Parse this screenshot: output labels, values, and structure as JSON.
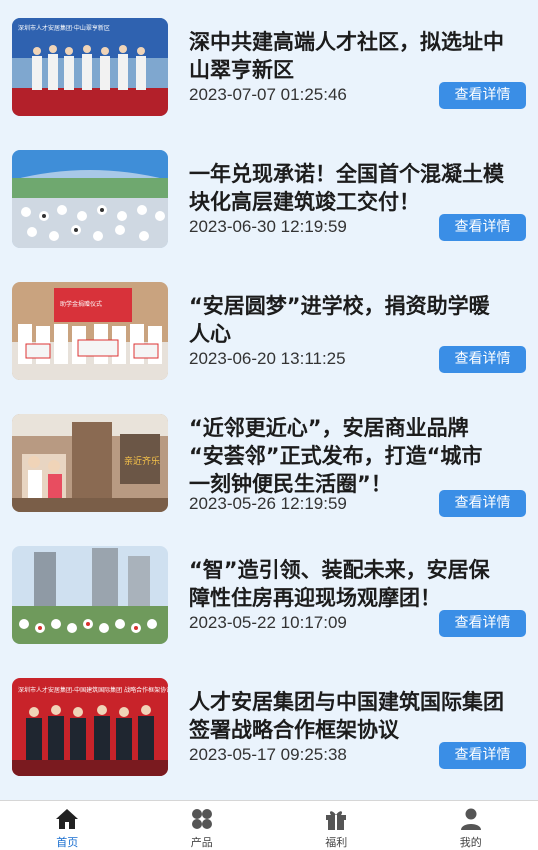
{
  "news": [
    {
      "title_line1": "深中共建高端人才社区，拟选址中",
      "title_line2": "山翠亨新区",
      "date": "2023-07-07 01:25:46",
      "button": "查看详情",
      "image": "signing-ceremony-photo"
    },
    {
      "title_line1": "一年兑现承诺！全国首个混凝土模",
      "title_line2": "块化高层建筑竣工交付！",
      "date": "2023-06-30 12:19:59",
      "button": "查看详情",
      "image": "event-tent-photo"
    },
    {
      "title_line1": "“安居圆梦”进学校，捐资助学暖",
      "title_line2": "人心",
      "date": "2023-06-20 13:11:25",
      "button": "查看详情",
      "image": "school-donation-photo"
    },
    {
      "title_line1": "“近邻更近心”，安居商业品牌",
      "title_line2": "“安荟邻”正式发布，打造“城市",
      "title_line3": "一刻钟便民生活圈”！",
      "date": "2023-05-26 12:19:59",
      "button": "查看详情",
      "image": "community-store-photo"
    },
    {
      "title_line1": "“智”造引领、装配未来，安居保",
      "title_line2": "障性住房再迎现场观摩团！",
      "date": "2023-05-22 10:17:09",
      "button": "查看详情",
      "image": "construction-site-photo"
    },
    {
      "title_line1": "人才安居集团与中国建筑国际集团",
      "title_line2": "签署战略合作框架协议",
      "date": "2023-05-17 09:25:38",
      "button": "查看详情",
      "image": "agreement-signing-photo"
    }
  ],
  "thumb_text": {
    "banner_1": "深圳市人才安居集团·中山翠亨新区",
    "banner_3": "助学金捐赠仪式",
    "sign_4": "亲近齐乐",
    "banner_6": "深圳市人才安居集团-中国建筑国际集团 战略合作框架协议签署仪式"
  },
  "tabs": [
    {
      "label": "首页",
      "icon": "home-icon",
      "active": true
    },
    {
      "label": "产品",
      "icon": "grid-icon",
      "active": false
    },
    {
      "label": "福利",
      "icon": "gift-icon",
      "active": false
    },
    {
      "label": "我的",
      "icon": "user-icon",
      "active": false
    }
  ],
  "colors": {
    "accent": "#3a8ee6",
    "background": "#eaf3fc",
    "active_tab": "#1a6fd0"
  }
}
